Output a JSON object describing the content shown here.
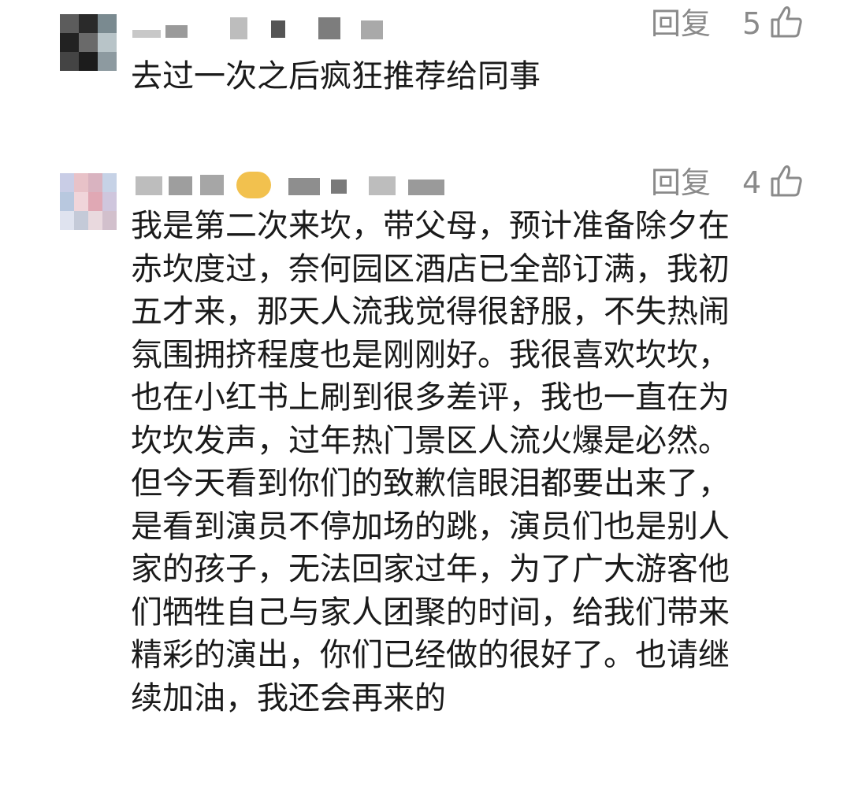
{
  "comments": [
    {
      "reply_label": "回复",
      "likes": "5",
      "text": "去过一次之后疯狂推荐给同事"
    },
    {
      "reply_label": "回复",
      "likes": "4",
      "text": "我是第二次来坎，带父母，预计准备除夕在\n赤坎度过，奈何园区酒店已全部订满，我初\n五才来，那天人流我觉得很舒服，不失热闹\n氛围拥挤程度也是刚刚好。我很喜欢坎坎，\n也在小红书上刷到很多差评，我也一直在为\n坎坎发声，过年热门景区人流火爆是必然。\n但今天看到你们的致歉信眼泪都要出来了，\n是看到演员不停加场的跳，演员们也是别人\n家的孩子，无法回家过年，为了广大游客他\n们牺牲自己与家人团聚的时间，给我们带来\n精彩的演出，你们已经做的很好了。也请继\n续加油，我还会再来的"
    }
  ],
  "colors": {
    "secondary_text": "#8a8a8a",
    "body_text": "#1a1a1a"
  },
  "icons": {
    "like": "thumbs-up-icon"
  }
}
